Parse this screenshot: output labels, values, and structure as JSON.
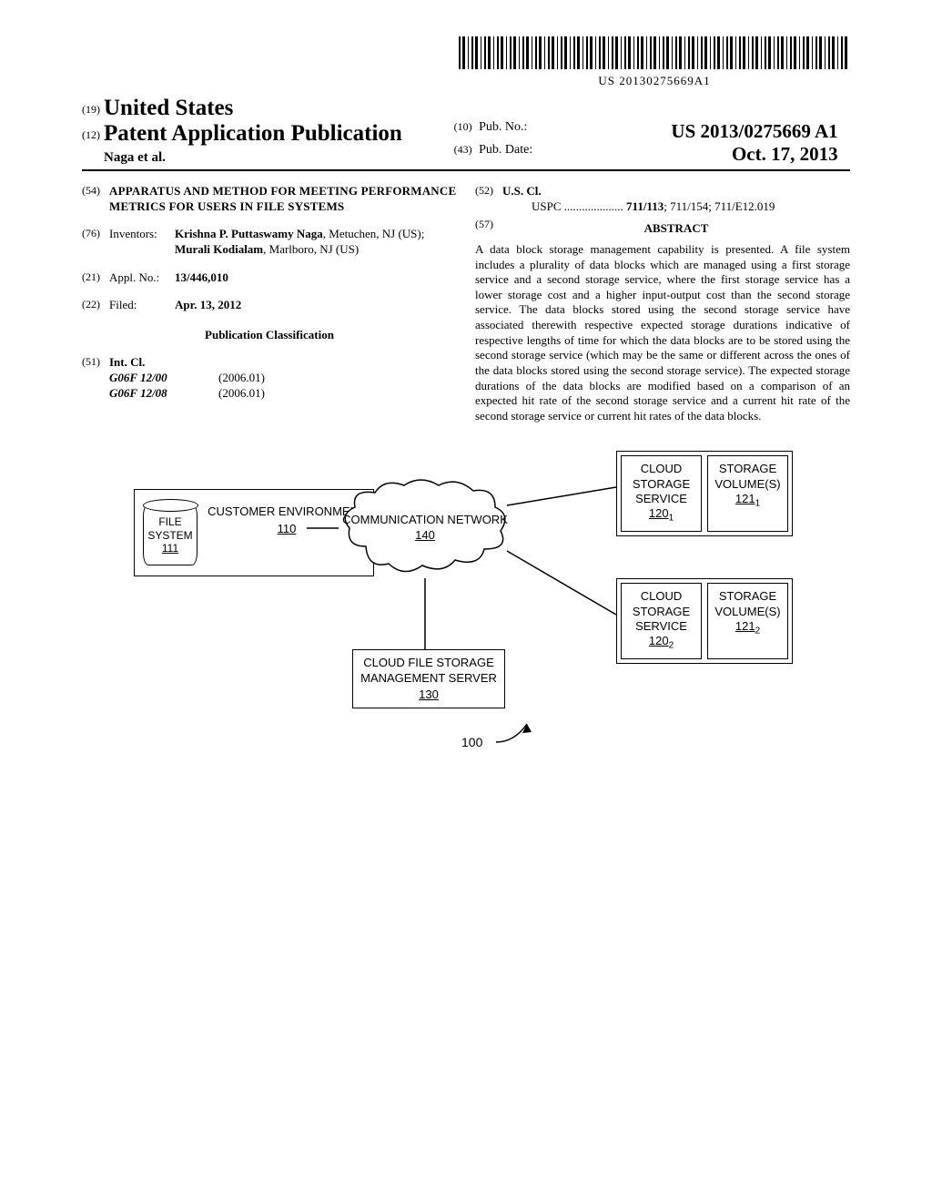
{
  "barcode_text": "US 20130275669A1",
  "header": {
    "country_code": "(19)",
    "country": "United States",
    "pub_type_code": "(12)",
    "pub_type": "Patent Application Publication",
    "authors": "Naga et al.",
    "pubno_code": "(10)",
    "pubno_label": "Pub. No.:",
    "pubno_value": "US 2013/0275669 A1",
    "pubdate_code": "(43)",
    "pubdate_label": "Pub. Date:",
    "pubdate_value": "Oct. 17, 2013"
  },
  "left_col": {
    "title_code": "(54)",
    "title": "APPARATUS AND METHOD FOR MEETING PERFORMANCE METRICS FOR USERS IN FILE SYSTEMS",
    "inventors_code": "(76)",
    "inventors_label": "Inventors:",
    "inventors_html": "Krishna P. Puttaswamy Naga, Metuchen, NJ (US); Murali Kodialam, Marlboro, NJ (US)",
    "inv_name1": "Krishna P. Puttaswamy Naga",
    "inv_loc1": ", Metuchen, NJ (US); ",
    "inv_name2": "Murali Kodialam",
    "inv_loc2": ", Marlboro, NJ (US)",
    "applno_code": "(21)",
    "applno_label": "Appl. No.:",
    "applno_value": "13/446,010",
    "filed_code": "(22)",
    "filed_label": "Filed:",
    "filed_value": "Apr. 13, 2012",
    "pubclass_heading": "Publication Classification",
    "intcl_code": "(51)",
    "intcl_label": "Int. Cl.",
    "intcl_rows": [
      {
        "cls": "G06F 12/00",
        "ver": "(2006.01)"
      },
      {
        "cls": "G06F 12/08",
        "ver": "(2006.01)"
      }
    ]
  },
  "right_col": {
    "uscl_code": "(52)",
    "uscl_label": "U.S. Cl.",
    "uspc_label": "USPC",
    "uspc_lead": "711/113",
    "uspc_rest": "; 711/154; 711/E12.019",
    "abstract_code": "(57)",
    "abstract_label": "ABSTRACT",
    "abstract_text": "A data block storage management capability is presented. A file system includes a plurality of data blocks which are managed using a first storage service and a second storage service, where the first storage service has a lower storage cost and a higher input-output cost than the second storage service. The data blocks stored using the second storage service have associated therewith respective expected storage durations indicative of respective lengths of time for which the data blocks are to be stored using the second storage service (which may be the same or different across the ones of the data blocks stored using the second storage service). The expected storage durations of the data blocks are modified based on a comparison of an expected hit rate of the second storage service and a current hit rate of the second storage service or current hit rates of the data blocks."
  },
  "figure": {
    "file_system": {
      "label": "FILE SYSTEM",
      "ref": "111"
    },
    "customer_env": {
      "label": "CUSTOMER ENVIRONMENT",
      "ref": "110"
    },
    "comm_network": {
      "label": "COMMUNICATION NETWORK",
      "ref": "140"
    },
    "mgmt_server": {
      "label": "CLOUD FILE STORAGE MANAGEMENT SERVER",
      "ref": "130"
    },
    "css1": {
      "label": "CLOUD STORAGE SERVICE",
      "ref": "120",
      "sub": "1"
    },
    "sv1": {
      "label": "STORAGE VOLUME(S)",
      "ref": "121",
      "sub": "1"
    },
    "css2": {
      "label": "CLOUD STORAGE SERVICE",
      "ref": "120",
      "sub": "2"
    },
    "sv2": {
      "label": "STORAGE VOLUME(S)",
      "ref": "121",
      "sub": "2"
    },
    "overall_ref": "100"
  }
}
